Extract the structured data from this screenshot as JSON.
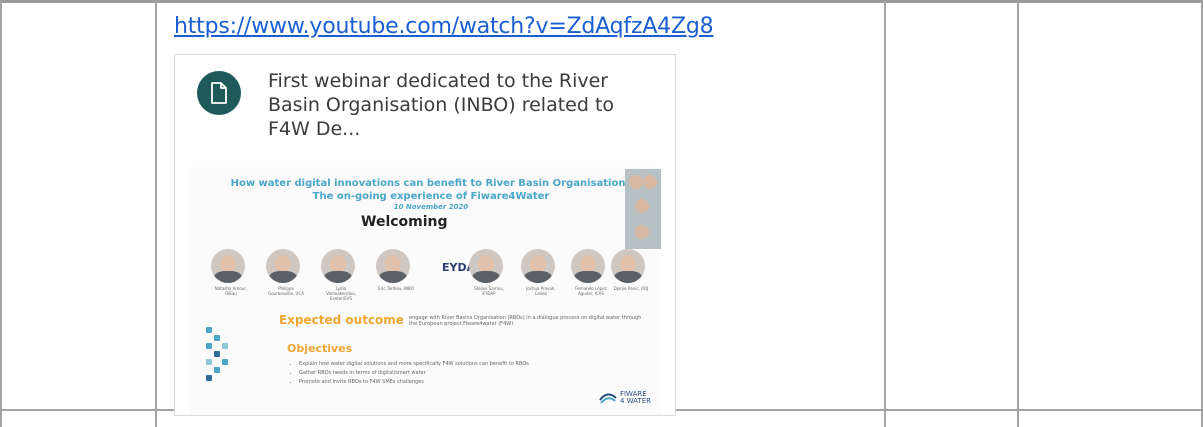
{
  "link": {
    "text": "https://www.youtube.com/watch?v=ZdAqfzA4Zg8"
  },
  "card": {
    "title": "First webinar dedicated to the River Basin Organisation (INBO) related to F4W De...",
    "icon": "document-icon",
    "badge_color": "#1f5a5a"
  },
  "slide": {
    "heading_line1": "How water digital innovations can benefit to River Basin Organisations",
    "heading_line2": "The on-going experience of Fiware4Water",
    "date": "10 November 2020",
    "welcoming": "Welcoming",
    "eydap": "EYDAP",
    "people": [
      {
        "name": "Natasha Amour, OIEau"
      },
      {
        "name": "Philippe Gourbesville, UCA"
      },
      {
        "name": "Lydia Vamvakeridou, Exeter/EVS"
      },
      {
        "name": "Eric Tardieu, INBO"
      },
      {
        "name": "Stelios Sarrios, EYDAP"
      },
      {
        "name": "Joshua Provoh, Cedex"
      },
      {
        "name": "Fernando López Aguilar, ICAS"
      },
      {
        "name": "Djorjie Panic, ROJ"
      }
    ],
    "expected_title": "Expected outcome",
    "expected_desc": "engage with River Basins Organisation (RBOs) in a dialogue process on digital water through the European project Fiware4water (F4W)",
    "objectives_title": "Objectives",
    "objectives": [
      "Explain how water digital solutions and more specifically F4W solutions can benefit to RBOs",
      "Gather RBOs needs in terms of digital/smart water",
      "Promote and invite RBOs to F4W SMEs challenges"
    ],
    "fiware_logo_line1": "FIWARE",
    "fiware_logo_line2": "4 WATER"
  },
  "colors": {
    "link": "#1a5fd1",
    "accent_blue": "#4aa6c8",
    "accent_orange": "#f0a733"
  }
}
